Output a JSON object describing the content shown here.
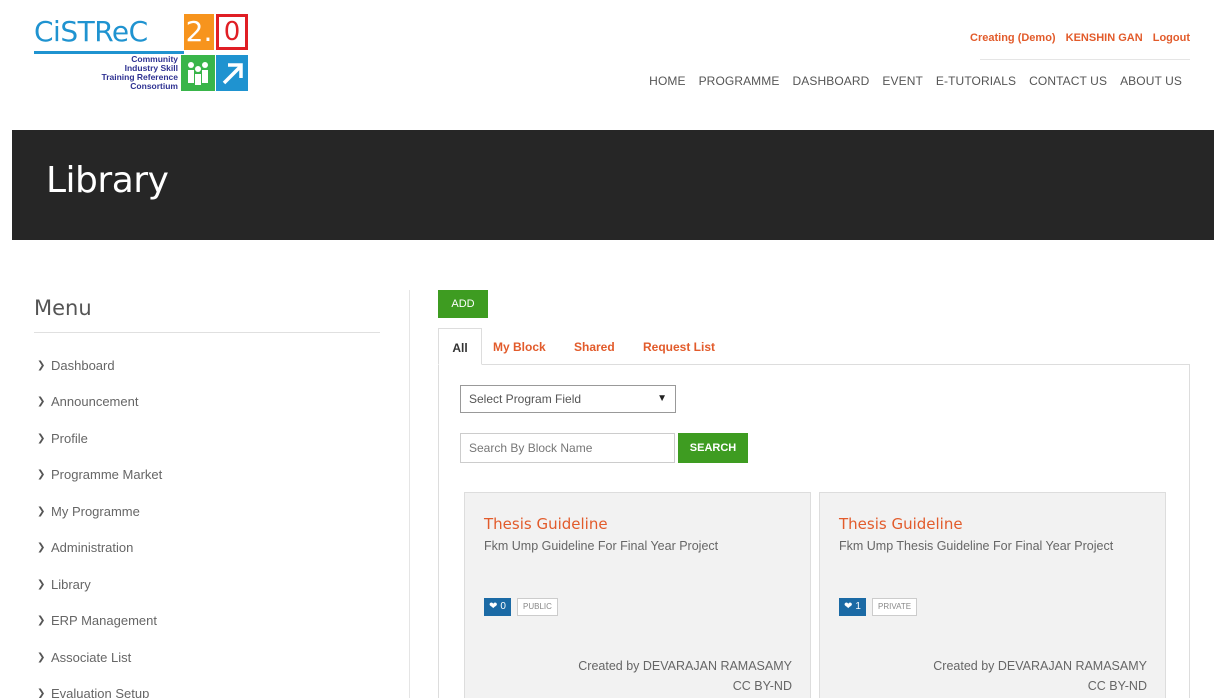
{
  "logo": {
    "brand": "CiSTReC",
    "version_major": "2.",
    "version_minor": "0",
    "subtitle": [
      "Community",
      "Industry Skill",
      "Training Reference",
      "Consortium"
    ],
    "colors": {
      "blue": "#1f93d0",
      "orange": "#f7941d",
      "red": "#e01e24",
      "green": "#39b54a",
      "navy": "#2e3192"
    }
  },
  "top_links": {
    "creating": "Creating (Demo)",
    "user": "KENSHIN GAN",
    "logout": "Logout"
  },
  "main_nav": [
    "HOME",
    "PROGRAMME",
    "DASHBOARD",
    "EVENT",
    "E-TUTORIALS",
    "CONTACT US",
    "ABOUT US"
  ],
  "banner": {
    "title": "Library"
  },
  "sidebar": {
    "title": "Menu",
    "items": [
      {
        "label": "Dashboard"
      },
      {
        "label": "Announcement"
      },
      {
        "label": "Profile"
      },
      {
        "label": "Programme Market"
      },
      {
        "label": "My Programme"
      },
      {
        "label": "Administration"
      },
      {
        "label": "Library"
      },
      {
        "label": "ERP Management"
      },
      {
        "label": "Associate List"
      },
      {
        "label": "Evaluation Setup"
      }
    ]
  },
  "toolbar": {
    "add_label": "ADD"
  },
  "tabs": [
    {
      "label": "All",
      "active": true
    },
    {
      "label": "My Block"
    },
    {
      "label": "Shared"
    },
    {
      "label": "Request List"
    }
  ],
  "filters": {
    "program_field": "Select Program Field",
    "search_placeholder": "Search By Block Name",
    "search_label": "SEARCH"
  },
  "cards": [
    {
      "title": "Thesis Guideline",
      "description": "Fkm Ump Guideline For Final Year Project",
      "likes": "0",
      "visibility": "PUBLIC",
      "created_by": "Created by DEVARAJAN RAMASAMY",
      "license": "CC BY-ND"
    },
    {
      "title": "Thesis Guideline",
      "description": "Fkm Ump Thesis Guideline For Final Year Project",
      "likes": "1",
      "visibility": "PRIVATE",
      "created_by": "Created by DEVARAJAN RAMASAMY",
      "license": "CC BY-ND"
    }
  ],
  "colors": {
    "accent": "#e25b2b",
    "button_green": "#3e9c21",
    "banner_bg": "#262626",
    "badge_blue": "#1b6aa5"
  }
}
